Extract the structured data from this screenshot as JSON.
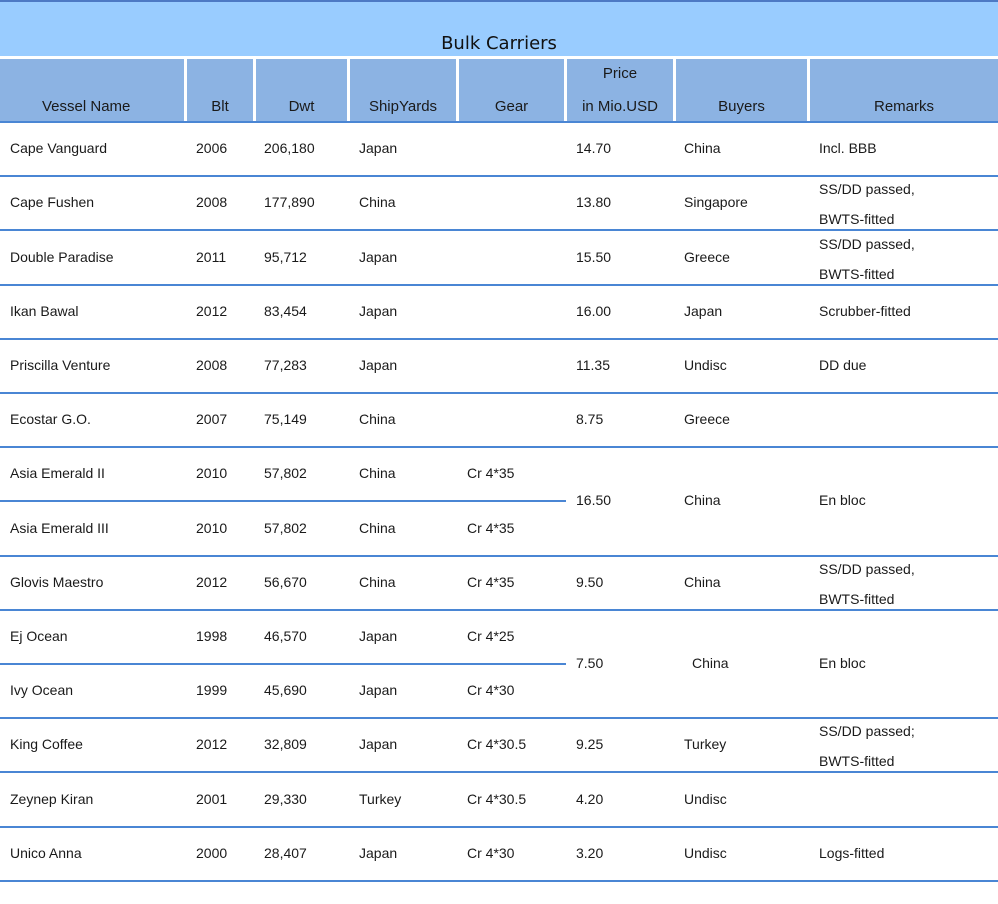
{
  "title": "Bulk Carriers",
  "headers": {
    "vessel": "Vessel Name",
    "built": "Blt",
    "dwt": "Dwt",
    "yards": "ShipYards",
    "gear": "Gear",
    "price_top": "Price",
    "price_bottom": "in Mio.USD",
    "buyers": "Buyers",
    "remarks": "Remarks"
  },
  "rows": [
    {
      "vessel": "Cape Vanguard",
      "built": "2006",
      "dwt": "206,180",
      "yards": "Japan",
      "gear": "",
      "price": "14.70",
      "buyers": "China",
      "remarks": [
        "Incl. BBB"
      ]
    },
    {
      "vessel": "Cape Fushen",
      "built": "2008",
      "dwt": "177,890",
      "yards": "China",
      "gear": "",
      "price": "13.80",
      "buyers": "Singapore",
      "remarks": [
        "SS/DD passed,",
        "BWTS-fitted"
      ]
    },
    {
      "vessel": "Double Paradise",
      "built": "2011",
      "dwt": "95,712",
      "yards": "Japan",
      "gear": "",
      "price": "15.50",
      "buyers": "Greece",
      "remarks": [
        "SS/DD passed,",
        "BWTS-fitted"
      ]
    },
    {
      "vessel": "Ikan Bawal",
      "built": "2012",
      "dwt": "83,454",
      "yards": "Japan",
      "gear": "",
      "price": "16.00",
      "buyers": "Japan",
      "remarks": [
        "Scrubber-fitted"
      ]
    },
    {
      "vessel": "Priscilla Venture",
      "built": "2008",
      "dwt": "77,283",
      "yards": "Japan",
      "gear": "",
      "price": "11.35",
      "buyers": "Undisc",
      "remarks": [
        "DD due"
      ]
    },
    {
      "vessel": "Ecostar G.O.",
      "built": "2007",
      "dwt": "75,149",
      "yards": "China",
      "gear": "",
      "price": "8.75",
      "buyers": "Greece",
      "remarks": []
    },
    {
      "vessel": "Asia Emerald II",
      "built": "2010",
      "dwt": "57,802",
      "yards": "China",
      "gear": "Cr 4*35"
    },
    {
      "vessel": "Asia Emerald III",
      "built": "2010",
      "dwt": "57,802",
      "yards": "China",
      "gear": "Cr 4*35"
    },
    {
      "vessel": "Glovis Maestro",
      "built": "2012",
      "dwt": "56,670",
      "yards": "China",
      "gear": "Cr 4*35",
      "price": "9.50",
      "buyers": "China",
      "remarks": [
        "SS/DD passed,",
        "BWTS-fitted"
      ]
    },
    {
      "vessel": "Ej Ocean",
      "built": "1998",
      "dwt": "46,570",
      "yards": "Japan",
      "gear": "Cr 4*25"
    },
    {
      "vessel": "Ivy Ocean",
      "built": "1999",
      "dwt": "45,690",
      "yards": "Japan",
      "gear": "Cr 4*30"
    },
    {
      "vessel": "King Coffee",
      "built": "2012",
      "dwt": "32,809",
      "yards": "Japan",
      "gear": "Cr 4*30.5",
      "price": "9.25",
      "buyers": "Turkey",
      "remarks": [
        "SS/DD passed;",
        "BWTS-fitted"
      ]
    },
    {
      "vessel": "Zeynep Kiran",
      "built": "2001",
      "dwt": "29,330",
      "yards": "Turkey",
      "gear": "Cr 4*30.5",
      "price": "4.20",
      "buyers": "Undisc",
      "remarks": []
    },
    {
      "vessel": "Unico Anna",
      "built": "2000",
      "dwt": "28,407",
      "yards": "Japan",
      "gear": "Cr 4*30",
      "price": "3.20",
      "buyers": "Undisc",
      "remarks": [
        "Logs-fitted"
      ]
    }
  ],
  "merged": [
    {
      "price": "16.50",
      "buyers": "China",
      "remarks": [
        "En bloc"
      ]
    },
    {
      "price": "7.50",
      "buyers": "China",
      "remarks": [
        "En bloc"
      ]
    }
  ],
  "colors": {
    "title_bg": "#99ccff",
    "header_bg": "#8cb3e3",
    "rule": "#4a86d4"
  }
}
